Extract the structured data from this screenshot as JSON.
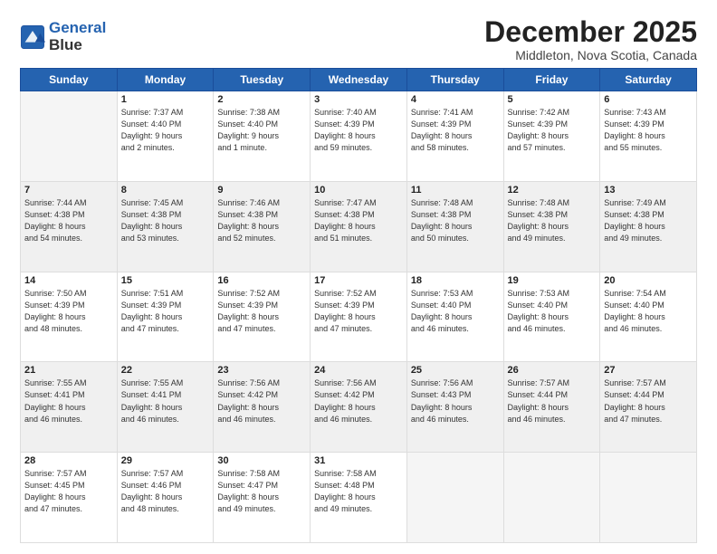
{
  "logo": {
    "line1": "General",
    "line2": "Blue"
  },
  "header": {
    "month": "December 2025",
    "location": "Middleton, Nova Scotia, Canada"
  },
  "days_of_week": [
    "Sunday",
    "Monday",
    "Tuesday",
    "Wednesday",
    "Thursday",
    "Friday",
    "Saturday"
  ],
  "weeks": [
    [
      {
        "day": "",
        "info": ""
      },
      {
        "day": "1",
        "info": "Sunrise: 7:37 AM\nSunset: 4:40 PM\nDaylight: 9 hours\nand 2 minutes."
      },
      {
        "day": "2",
        "info": "Sunrise: 7:38 AM\nSunset: 4:40 PM\nDaylight: 9 hours\nand 1 minute."
      },
      {
        "day": "3",
        "info": "Sunrise: 7:40 AM\nSunset: 4:39 PM\nDaylight: 8 hours\nand 59 minutes."
      },
      {
        "day": "4",
        "info": "Sunrise: 7:41 AM\nSunset: 4:39 PM\nDaylight: 8 hours\nand 58 minutes."
      },
      {
        "day": "5",
        "info": "Sunrise: 7:42 AM\nSunset: 4:39 PM\nDaylight: 8 hours\nand 57 minutes."
      },
      {
        "day": "6",
        "info": "Sunrise: 7:43 AM\nSunset: 4:39 PM\nDaylight: 8 hours\nand 55 minutes."
      }
    ],
    [
      {
        "day": "7",
        "info": "Sunrise: 7:44 AM\nSunset: 4:38 PM\nDaylight: 8 hours\nand 54 minutes."
      },
      {
        "day": "8",
        "info": "Sunrise: 7:45 AM\nSunset: 4:38 PM\nDaylight: 8 hours\nand 53 minutes."
      },
      {
        "day": "9",
        "info": "Sunrise: 7:46 AM\nSunset: 4:38 PM\nDaylight: 8 hours\nand 52 minutes."
      },
      {
        "day": "10",
        "info": "Sunrise: 7:47 AM\nSunset: 4:38 PM\nDaylight: 8 hours\nand 51 minutes."
      },
      {
        "day": "11",
        "info": "Sunrise: 7:48 AM\nSunset: 4:38 PM\nDaylight: 8 hours\nand 50 minutes."
      },
      {
        "day": "12",
        "info": "Sunrise: 7:48 AM\nSunset: 4:38 PM\nDaylight: 8 hours\nand 49 minutes."
      },
      {
        "day": "13",
        "info": "Sunrise: 7:49 AM\nSunset: 4:38 PM\nDaylight: 8 hours\nand 49 minutes."
      }
    ],
    [
      {
        "day": "14",
        "info": "Sunrise: 7:50 AM\nSunset: 4:39 PM\nDaylight: 8 hours\nand 48 minutes."
      },
      {
        "day": "15",
        "info": "Sunrise: 7:51 AM\nSunset: 4:39 PM\nDaylight: 8 hours\nand 47 minutes."
      },
      {
        "day": "16",
        "info": "Sunrise: 7:52 AM\nSunset: 4:39 PM\nDaylight: 8 hours\nand 47 minutes."
      },
      {
        "day": "17",
        "info": "Sunrise: 7:52 AM\nSunset: 4:39 PM\nDaylight: 8 hours\nand 47 minutes."
      },
      {
        "day": "18",
        "info": "Sunrise: 7:53 AM\nSunset: 4:40 PM\nDaylight: 8 hours\nand 46 minutes."
      },
      {
        "day": "19",
        "info": "Sunrise: 7:53 AM\nSunset: 4:40 PM\nDaylight: 8 hours\nand 46 minutes."
      },
      {
        "day": "20",
        "info": "Sunrise: 7:54 AM\nSunset: 4:40 PM\nDaylight: 8 hours\nand 46 minutes."
      }
    ],
    [
      {
        "day": "21",
        "info": "Sunrise: 7:55 AM\nSunset: 4:41 PM\nDaylight: 8 hours\nand 46 minutes."
      },
      {
        "day": "22",
        "info": "Sunrise: 7:55 AM\nSunset: 4:41 PM\nDaylight: 8 hours\nand 46 minutes."
      },
      {
        "day": "23",
        "info": "Sunrise: 7:56 AM\nSunset: 4:42 PM\nDaylight: 8 hours\nand 46 minutes."
      },
      {
        "day": "24",
        "info": "Sunrise: 7:56 AM\nSunset: 4:42 PM\nDaylight: 8 hours\nand 46 minutes."
      },
      {
        "day": "25",
        "info": "Sunrise: 7:56 AM\nSunset: 4:43 PM\nDaylight: 8 hours\nand 46 minutes."
      },
      {
        "day": "26",
        "info": "Sunrise: 7:57 AM\nSunset: 4:44 PM\nDaylight: 8 hours\nand 46 minutes."
      },
      {
        "day": "27",
        "info": "Sunrise: 7:57 AM\nSunset: 4:44 PM\nDaylight: 8 hours\nand 47 minutes."
      }
    ],
    [
      {
        "day": "28",
        "info": "Sunrise: 7:57 AM\nSunset: 4:45 PM\nDaylight: 8 hours\nand 47 minutes."
      },
      {
        "day": "29",
        "info": "Sunrise: 7:57 AM\nSunset: 4:46 PM\nDaylight: 8 hours\nand 48 minutes."
      },
      {
        "day": "30",
        "info": "Sunrise: 7:58 AM\nSunset: 4:47 PM\nDaylight: 8 hours\nand 49 minutes."
      },
      {
        "day": "31",
        "info": "Sunrise: 7:58 AM\nSunset: 4:48 PM\nDaylight: 8 hours\nand 49 minutes."
      },
      {
        "day": "",
        "info": ""
      },
      {
        "day": "",
        "info": ""
      },
      {
        "day": "",
        "info": ""
      }
    ]
  ]
}
